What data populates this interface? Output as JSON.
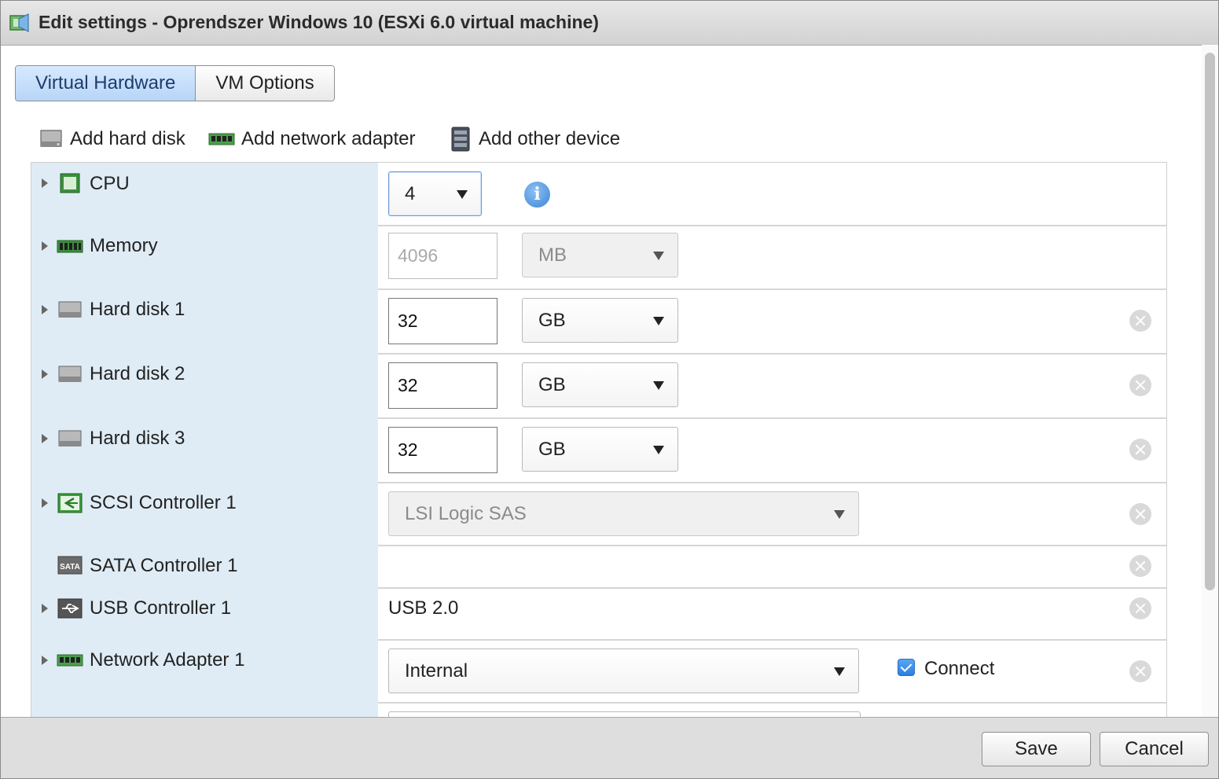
{
  "window": {
    "title": "Edit settings - Oprendszer Windows 10 (ESXi 6.0 virtual machine)"
  },
  "tabs": [
    {
      "label": "Virtual Hardware",
      "active": true
    },
    {
      "label": "VM Options",
      "active": false
    }
  ],
  "toolbar": {
    "add_hard_disk": "Add hard disk",
    "add_network_adapter": "Add network adapter",
    "add_other_device": "Add other device"
  },
  "hardware": {
    "cpu": {
      "label": "CPU",
      "value": "4"
    },
    "memory": {
      "label": "Memory",
      "value": "4096",
      "unit": "MB"
    },
    "hard_disk_1": {
      "label": "Hard disk 1",
      "value": "32",
      "unit": "GB"
    },
    "hard_disk_2": {
      "label": "Hard disk 2",
      "value": "32",
      "unit": "GB"
    },
    "hard_disk_3": {
      "label": "Hard disk 3",
      "value": "32",
      "unit": "GB"
    },
    "scsi_controller_1": {
      "label": "SCSI Controller 1",
      "value": "LSI Logic SAS"
    },
    "sata_controller_1": {
      "label": "SATA Controller 1"
    },
    "usb_controller_1": {
      "label": "USB Controller 1",
      "value": "USB 2.0"
    },
    "network_adapter_1": {
      "label": "Network Adapter 1",
      "value": "Internal",
      "connect_label": "Connect",
      "connected": true
    }
  },
  "footer": {
    "save": "Save",
    "cancel": "Cancel"
  },
  "colors": {
    "label_column_bg": "#dfecf5",
    "active_tab": "#b7d5f7",
    "footer_bg": "#dedede",
    "checkbox": "#2d7fe0"
  }
}
